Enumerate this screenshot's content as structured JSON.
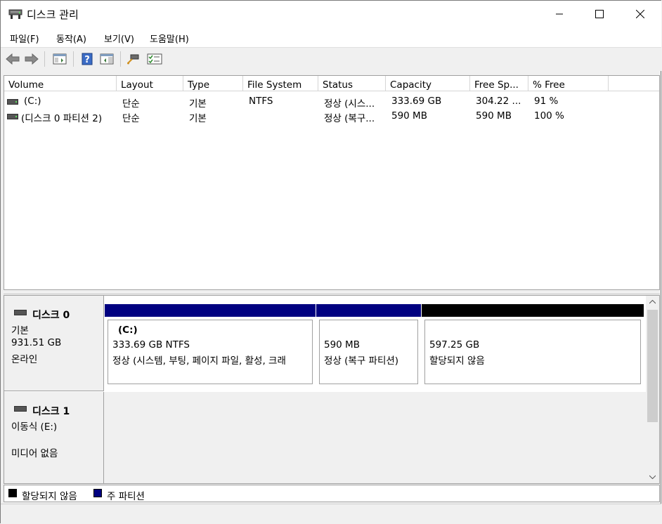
{
  "window": {
    "title": "디스크 관리",
    "controls": [
      "minimize",
      "maximize",
      "close"
    ]
  },
  "menu": [
    "파일(F)",
    "동작(A)",
    "보기(V)",
    "도움말(H)"
  ],
  "toolbar": {
    "icons": [
      "back-arrow-icon",
      "forward-arrow-icon",
      "console-tree-icon",
      "help-icon",
      "show-action-pane-icon",
      "connect-icon",
      "properties-icon"
    ]
  },
  "volume_list": {
    "columns": [
      "Volume",
      "Layout",
      "Type",
      "File System",
      "Status",
      "Capacity",
      "Free Sp...",
      "% Free"
    ],
    "rows": [
      {
        "volume": "(C:)",
        "layout": "단순",
        "type": "기본",
        "fs": "NTFS",
        "status": "정상 (시스...",
        "capacity": "333.69 GB",
        "free": "304.22 ...",
        "pct": "91 %"
      },
      {
        "volume": "(디스크 0 파티션 2)",
        "layout": "단순",
        "type": "기본",
        "fs": "",
        "status": "정상 (복구...",
        "capacity": "590 MB",
        "free": "590 MB",
        "pct": "100 %"
      }
    ]
  },
  "disks": [
    {
      "name": "디스크 0",
      "kind": "기본",
      "size": "931.51 GB",
      "state": "온라인",
      "partitions": [
        {
          "label": "(C:)",
          "line1": "333.69 GB NTFS",
          "line2": "정상 (시스템, 부팅, 페이지 파일, 활성, 크래",
          "bar_color": "#000080"
        },
        {
          "label": "",
          "line1": "590 MB",
          "line2": "정상 (복구 파티션)",
          "bar_color": "#000080"
        },
        {
          "label": "",
          "line1": "597.25 GB",
          "line2": "할당되지 않음",
          "bar_color": "#000000"
        }
      ]
    },
    {
      "name": "디스크 1",
      "kind": "이동식 (E:)",
      "state": "미디어 없음"
    }
  ],
  "legend": [
    {
      "label": "할당되지 않음",
      "color": "#000000"
    },
    {
      "label": "주 파티션",
      "color": "#000080"
    }
  ]
}
